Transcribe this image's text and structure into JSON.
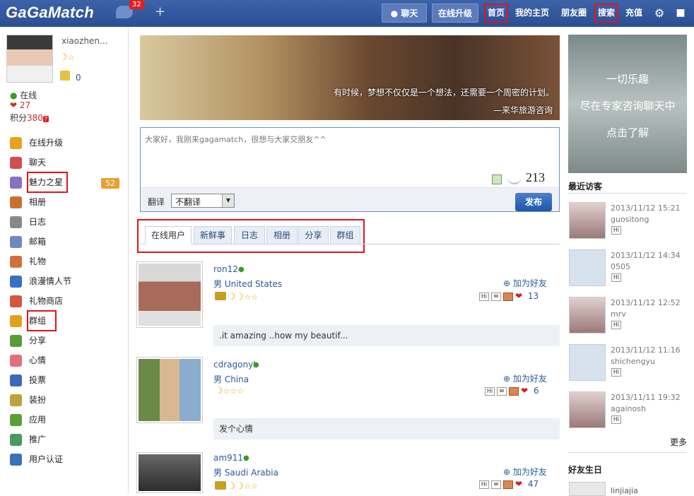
{
  "header": {
    "logo": "GaGaMatch",
    "message_count": "32",
    "nav": [
      "聊天",
      "在线升级",
      "首页",
      "我的主页",
      "朋友圈",
      "搜索",
      "充值"
    ]
  },
  "profile": {
    "username": "xiaozhen...",
    "coins": "0",
    "online": "在线",
    "hearts": "27",
    "points_label": "积分",
    "points": "380"
  },
  "sidebar": {
    "items": [
      {
        "label": "在线升级",
        "icon": "upgrade-arrow-icon"
      },
      {
        "label": "聊天",
        "icon": "chat-person-icon"
      },
      {
        "label": "魅力之星",
        "icon": "charm-star-icon",
        "badge": "52"
      },
      {
        "label": "相册",
        "icon": "album-icon"
      },
      {
        "label": "日志",
        "icon": "diary-icon"
      },
      {
        "label": "邮箱",
        "icon": "mail-icon"
      },
      {
        "label": "礼物",
        "icon": "gift-icon"
      },
      {
        "label": "浪漫情人节",
        "icon": "valentine-icon"
      },
      {
        "label": "礼物商店",
        "icon": "gift-shop-icon"
      },
      {
        "label": "群组",
        "icon": "group-icon"
      },
      {
        "label": "分享",
        "icon": "share-icon"
      },
      {
        "label": "心情",
        "icon": "mood-heart-icon"
      },
      {
        "label": "投票",
        "icon": "vote-chart-icon"
      },
      {
        "label": "装扮",
        "icon": "dressup-brush-icon"
      },
      {
        "label": "应用",
        "icon": "apps-puzzle-icon"
      },
      {
        "label": "推广",
        "icon": "promote-globe-icon"
      },
      {
        "label": "用户认证",
        "icon": "verify-user-icon"
      }
    ]
  },
  "banner": {
    "line1": "有时候，梦想不仅仅是一个想法，还需要一个周密的计划。",
    "line2": "—来华旅游咨询"
  },
  "composer": {
    "placeholder": "大家好，我刚来gagamatch，很想与大家交朋友^^",
    "char_count": "213",
    "translate_label": "翻译",
    "translate_option": "不翻译",
    "publish": "发布"
  },
  "tabs": [
    "在线用户",
    "新鲜事",
    "日志",
    "相册",
    "分享",
    "群组"
  ],
  "feed": [
    {
      "name": "ron12",
      "location": "男 United States",
      "add_friend": "加为好友",
      "likes": "13",
      "status": ".it amazing ..how my beautif..."
    },
    {
      "name": "cdragonyl",
      "location": "男 China",
      "add_friend": "加为好友",
      "likes": "6",
      "status": "发个心情"
    },
    {
      "name": "am911",
      "location": "男 Saudi Arabia",
      "add_friend": "加为好友",
      "likes": "47"
    }
  ],
  "right_ad": {
    "line1": "一切乐趣",
    "line2": "尽在专家咨询聊天中",
    "line3": "点击了解"
  },
  "visitors": {
    "title": "最近访客",
    "more": "更多",
    "list": [
      {
        "time": "2013/11/12 15:21",
        "user": "guositong"
      },
      {
        "time": "2013/11/12 14:34",
        "user": "0505"
      },
      {
        "time": "2013/11/12 12:52",
        "user": "mrv"
      },
      {
        "time": "2013/11/12 11:16",
        "user": "shichengyu"
      },
      {
        "time": "2013/11/11 19:32",
        "user": "againosh"
      }
    ]
  },
  "friends_birthday": {
    "title": "好友生日",
    "first": "linjiajia"
  },
  "colors": {
    "topbar": "#2f5398",
    "accent": "#2a5a9a",
    "highlight": "#e0141e",
    "publish_button": "#2a5fae"
  }
}
